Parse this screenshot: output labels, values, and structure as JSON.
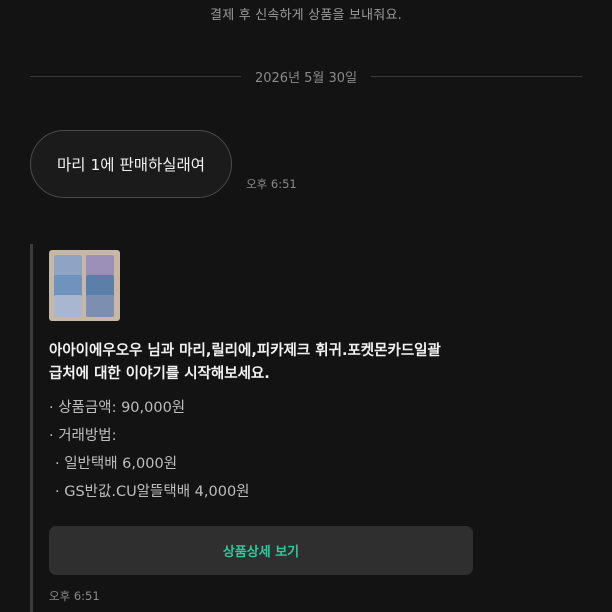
{
  "chat": {
    "top_notice": "결제 후 신속하게 상품을 보내줘요.",
    "date_divider": "2026년 5월 30일",
    "message": {
      "text": "마리 1에 판매하실래여",
      "time": "오후 6:51"
    },
    "product_card": {
      "thumbnail_icon": "pokemon-cards-photo",
      "title_line1": "아아이에우오우 님과 마리,릴리에,피카제크 휘귀.포켓몬카드일괄",
      "title_line2": "급처에 대한 이야기를 시작해보세요.",
      "price": "· 상품금액: 90,000원",
      "method_label": "· 거래방법:",
      "method_1": "· 일반택배 6,000원",
      "method_2": "· GS반값.CU알뜰택배 4,000원",
      "button_label": "상품상세 보기",
      "time": "오후 6:51"
    }
  },
  "colors": {
    "background": "#131313",
    "accent": "#36c49a",
    "bubble_border": "#4a4a4a",
    "button_bg": "#2f2f2f"
  }
}
